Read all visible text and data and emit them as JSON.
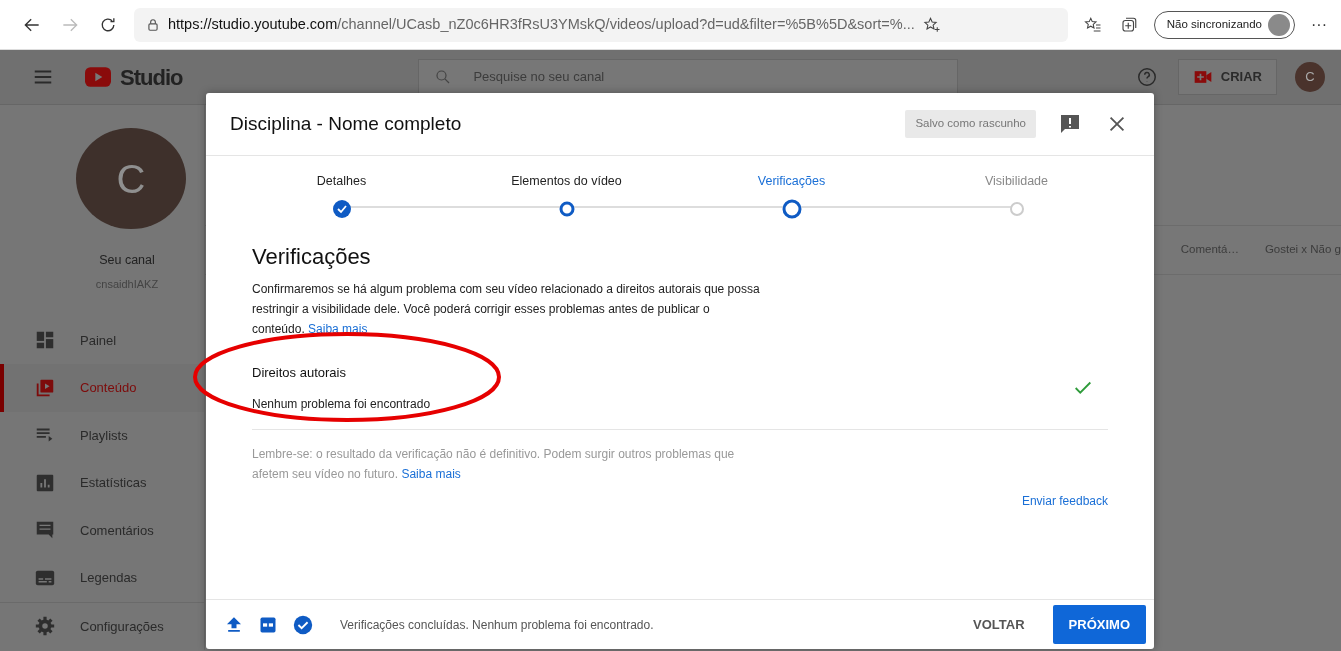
{
  "browser": {
    "url_host": "https://studio.youtube.com",
    "url_path": "/channel/UCasb_nZ0c6HR3fRsU3YMskQ/videos/upload?d=ud&filter=%5B%5D&sort=%...",
    "forward_disabled": true,
    "profile_label": "Não sincronizando",
    "more": "···"
  },
  "app": {
    "logo_text": "Studio",
    "search_placeholder": "Pesquise no seu canal",
    "create_label": "CRIAR",
    "avatar_letter": "C"
  },
  "channel": {
    "avatar_letter": "C",
    "title": "Seu canal",
    "handle": "cnsaidhIAKZ"
  },
  "sidebar": {
    "items": [
      {
        "label": "Painel",
        "selected": false
      },
      {
        "label": "Conteúdo",
        "selected": true
      },
      {
        "label": "Playlists",
        "selected": false
      },
      {
        "label": "Estatísticas",
        "selected": false
      },
      {
        "label": "Comentários",
        "selected": false
      },
      {
        "label": "Legendas",
        "selected": false
      }
    ],
    "footer_items": [
      {
        "label": "Configurações",
        "selected": false
      }
    ]
  },
  "background_table": {
    "columns": [
      "Comentá…",
      "Gostei x Não g"
    ]
  },
  "dialog": {
    "title": "Disciplina - Nome completo",
    "draft_badge": "Salvo como rascunho",
    "steps": [
      {
        "label": "Detalhes",
        "completed": true,
        "visited": true,
        "selected": false
      },
      {
        "label": "Elementos do vídeo",
        "completed": false,
        "visited": true,
        "selected": false
      },
      {
        "label": "Verificações",
        "completed": false,
        "visited": true,
        "selected": true
      },
      {
        "label": "Visibilidade",
        "completed": false,
        "visited": false,
        "selected": false
      }
    ],
    "heading": "Verificações",
    "description": "Confirmaremos se há algum problema com seu vídeo relacionado a direitos autorais que possa restringir a visibilidade dele. Você poderá corrigir esses problemas antes de publicar o conteúdo.",
    "description_link": "Saiba mais",
    "checks": [
      {
        "title": "Direitos autorais",
        "result": "Nenhum problema foi encontrado",
        "passed": true
      }
    ],
    "note": "Lembre-se: o resultado da verificação não é definitivo. Podem surgir outros problemas que afetem seu vídeo no futuro.",
    "note_link": "Saiba mais",
    "feedback_link": "Enviar feedback",
    "footer": {
      "status": "Verificações concluídas. Nenhum problema foi encontrado.",
      "back": "VOLTAR",
      "next": "PRÓXIMO"
    }
  },
  "annotation": {
    "color": "#e60000"
  }
}
